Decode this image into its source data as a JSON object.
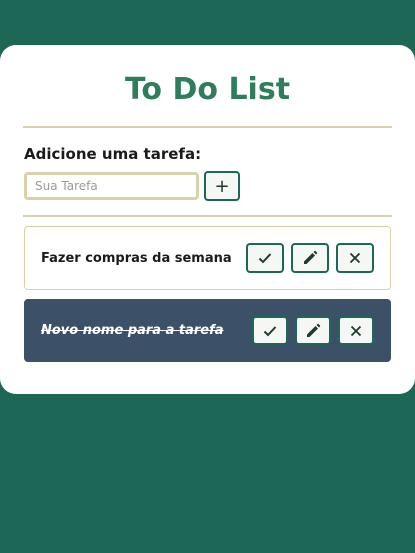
{
  "app": {
    "title": "To Do List"
  },
  "form": {
    "label": "Adicione uma tarefa:",
    "input_placeholder": "Sua Tarefa",
    "input_value": "",
    "add_button_label": "+"
  },
  "tasks": [
    {
      "title": "Fazer compras da semana",
      "done": false,
      "icons": [
        "check-icon",
        "pencil-icon",
        "close-icon"
      ]
    },
    {
      "title": "Novo nome para a tarefa",
      "done": true,
      "icons": [
        "check-icon",
        "pencil-icon",
        "close-icon"
      ]
    }
  ],
  "colors": {
    "background": "#1d6756",
    "title": "#2f7d5b",
    "divider": "#d9d2a8",
    "done_task_bg": "#3c5068",
    "button_border": "#1d6756"
  }
}
